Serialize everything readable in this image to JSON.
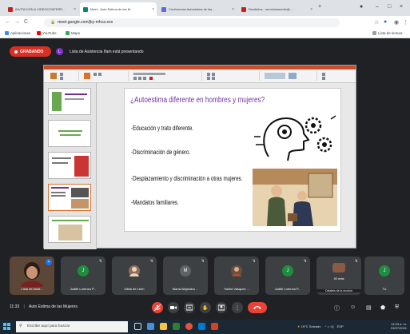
{
  "browser": {
    "tabs": [
      {
        "label": "INVITACIÓN A VIDEOCONFERE...",
        "color": "#c5221f"
      },
      {
        "label": "Meet - Auto Estima de las M...",
        "color": "#00897b"
      },
      {
        "label": "Conferencia Autoestima de las...",
        "color": "#5f6bd6"
      },
      {
        "label": "Recibidos - servicioamedio@...",
        "color": "#c5221f"
      }
    ],
    "url": "meet.google.com/jky-mhca-xxx",
    "bookmarks": [
      "Aplicaciones",
      "YouTube",
      "Maps"
    ],
    "reading_list": "Lista de lectura"
  },
  "meet": {
    "recording_label": "GRABANDO",
    "presenter_initial": "L",
    "presenting_text": "Lista de Asistencia Ifam está presentando",
    "meeting_time": "11:33",
    "meeting_name": "Auto Estima de las Mujeres"
  },
  "slide": {
    "title": "¿Autoestima diferente en hombres y mujeres?",
    "bullets": [
      "-Educación y trato diferente.",
      "-Discriminación de género.",
      "-Desplazamiento  y discriminación a otras mujeres.",
      "-Mandatos familiares."
    ]
  },
  "participants": [
    {
      "name": "Lista de Asist...",
      "initial": "",
      "color": "#6b4a3a"
    },
    {
      "name": "Judith Lorenza P...",
      "initial": "J",
      "color": "#1e8e3e"
    },
    {
      "name": "Gilda de León",
      "initial": "",
      "color": "#8d6e63"
    },
    {
      "name": "María Alejandra ...",
      "initial": "M",
      "color": "#5f6368"
    },
    {
      "name": "Yadira Vasquez ...",
      "initial": "",
      "color": "#6d4c41"
    },
    {
      "name": "Judith Lorenza P...",
      "initial": "J",
      "color": "#1e8e3e"
    },
    {
      "name": "40 más",
      "initial": "",
      "color": "#3c4043"
    },
    {
      "name": "Tú",
      "initial": "J",
      "color": "#1e8e3e"
    }
  ],
  "more_participants_detail": "Detalles de la reunión",
  "taskbar": {
    "search_placeholder": "Escribe aquí para buscar",
    "weather": "19°C Soleado",
    "lang": "ESP",
    "time": "11:33 a. m.",
    "date": "22/07/2021"
  }
}
